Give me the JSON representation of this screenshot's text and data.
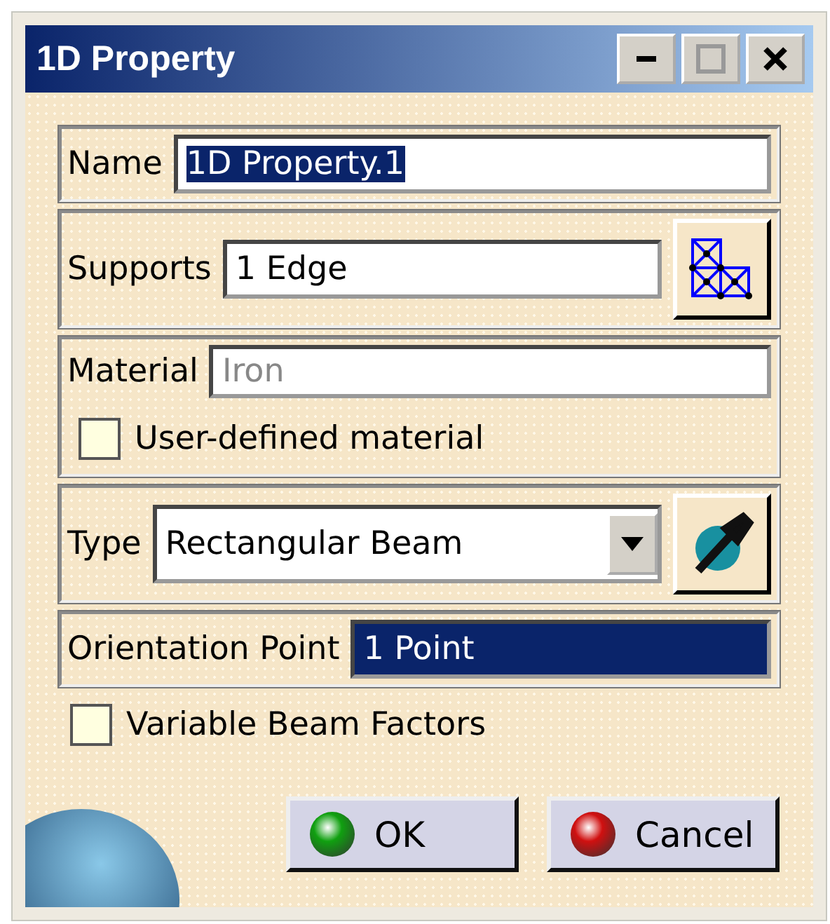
{
  "window": {
    "title": "1D Property"
  },
  "name": {
    "label": "Name",
    "value": "1D Property.1",
    "text_selected": true
  },
  "supports": {
    "label": "Supports",
    "value": "1 Edge"
  },
  "material": {
    "label": "Material",
    "value": "Iron",
    "disabled": true,
    "checkbox": {
      "label": "User-defined material",
      "checked": false
    }
  },
  "type": {
    "label": "Type",
    "value": "Rectangular Beam"
  },
  "orientation": {
    "label": "Orientation Point",
    "value": "1 Point",
    "selected": true
  },
  "variable_beam_factors": {
    "label": "Variable Beam Factors",
    "checked": false
  },
  "buttons": [
    {
      "label": "OK",
      "kind": "ok"
    },
    {
      "label": "Cancel",
      "kind": "cancel"
    }
  ]
}
